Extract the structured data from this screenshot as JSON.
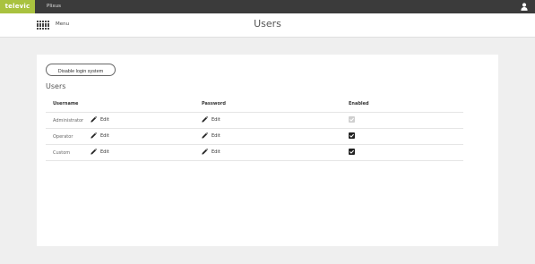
{
  "topbar": {
    "brand": "televic",
    "product": "Plixus",
    "user_icon": "user-icon"
  },
  "header": {
    "menu_label": "Menu",
    "menu_icon": "grid-menu-icon",
    "title": "Users"
  },
  "main": {
    "disable_button_label": "Disable login system",
    "section_title": "Users",
    "columns": {
      "username": "Username",
      "password": "Password",
      "enabled": "Enabled"
    },
    "rows": [
      {
        "username": "Administrator",
        "edit_user_label": "Edit",
        "edit_password_label": "Edit",
        "enabled": true,
        "enabled_locked": true
      },
      {
        "username": "Operator",
        "edit_user_label": "Edit",
        "edit_password_label": "Edit",
        "enabled": true,
        "enabled_locked": false
      },
      {
        "username": "Custom",
        "edit_user_label": "Edit",
        "edit_password_label": "Edit",
        "enabled": true,
        "enabled_locked": false
      }
    ]
  },
  "colors": {
    "brand": "#a9c23f",
    "topbar": "#3b3b3b",
    "background": "#efefef"
  }
}
